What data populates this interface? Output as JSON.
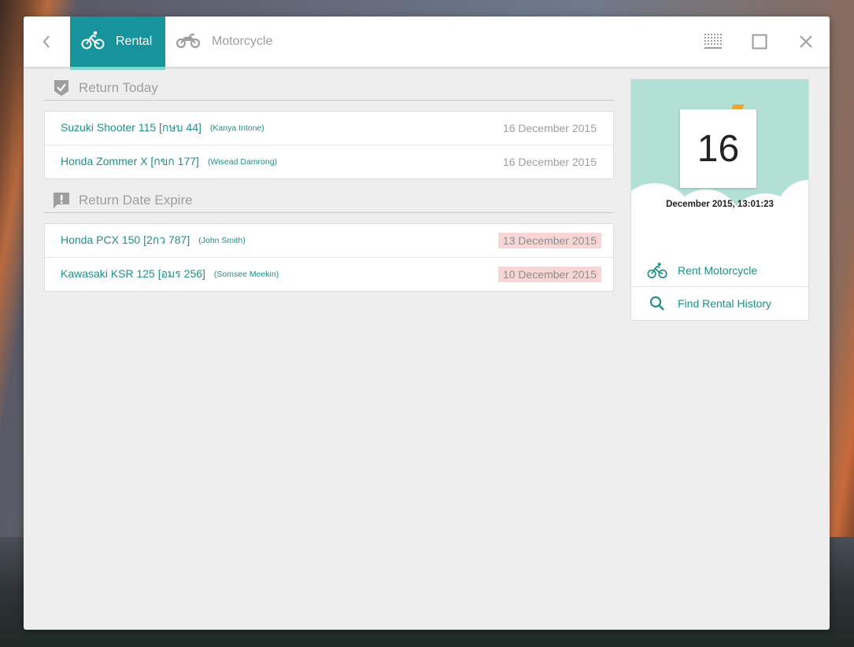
{
  "tabs": [
    {
      "label": "Rental",
      "icon": "bicycle-icon",
      "active": true
    },
    {
      "label": "Motorcycle",
      "icon": "motorcycle-icon",
      "active": false
    }
  ],
  "colors": {
    "accent": "#16939b",
    "link": "#1e9089",
    "expired_bg": "#f9d6d6",
    "calendar_bg": "#b2e0d5"
  },
  "return_today": {
    "title": "Return Today",
    "icon": "shield-check-icon",
    "items": [
      {
        "name": "Suzuki Shooter 115 [กษบ 44]",
        "person": "(Kanya Intone)",
        "date": "16 December 2015",
        "expired": false
      },
      {
        "name": "Honda Zommer X [กขก 177]",
        "person": "(Wisead Damrong)",
        "date": "16 December 2015",
        "expired": false
      }
    ]
  },
  "return_expire": {
    "title": "Return Date Expire",
    "icon": "alert-message-icon",
    "items": [
      {
        "name": "Honda PCX 150 [2กว 787]",
        "person": "(John Smith)",
        "date": "13 December 2015",
        "expired": true
      },
      {
        "name": "Kawasaki KSR 125 [อมร 256]",
        "person": "(Somsee Meekin)",
        "date": "10 December 2015",
        "expired": true
      }
    ]
  },
  "calendar": {
    "day": "16",
    "datetime": "December 2015, 13:01:23"
  },
  "actions": [
    {
      "label": "Rent Motorcycle",
      "icon": "bicycle-icon"
    },
    {
      "label": "Find Rental History",
      "icon": "search-icon"
    }
  ]
}
